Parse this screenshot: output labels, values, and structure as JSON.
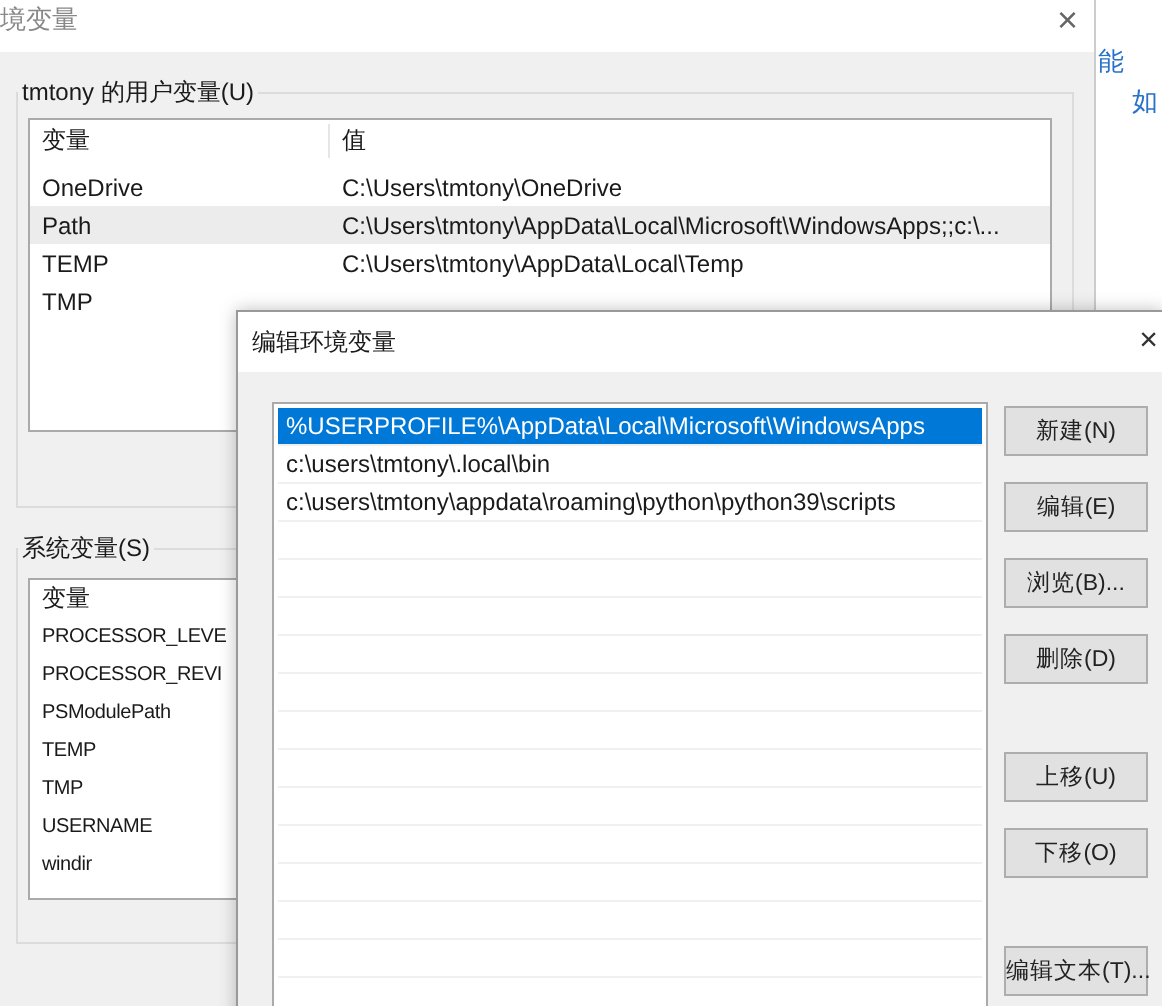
{
  "main_window": {
    "title": "境变量",
    "close": "×",
    "user_group": {
      "title": "tmtony 的用户变量(U)",
      "columns": [
        "变量",
        "值"
      ],
      "rows": [
        {
          "name": "OneDrive",
          "value": "C:\\Users\\tmtony\\OneDrive",
          "selected": false
        },
        {
          "name": "Path",
          "value": "C:\\Users\\tmtony\\AppData\\Local\\Microsoft\\WindowsApps;;c:\\...",
          "selected": true
        },
        {
          "name": "TEMP",
          "value": "C:\\Users\\tmtony\\AppData\\Local\\Temp",
          "selected": false
        },
        {
          "name": "TMP",
          "selected": false
        }
      ]
    },
    "system_group": {
      "title": "系统变量(S)",
      "columns": [
        "变量"
      ],
      "rows": [
        {
          "name": "PROCESSOR_LEVE"
        },
        {
          "name": "PROCESSOR_REVI"
        },
        {
          "name": "PSModulePath"
        },
        {
          "name": "TEMP"
        },
        {
          "name": "TMP"
        },
        {
          "name": "USERNAME"
        },
        {
          "name": "windir"
        }
      ]
    }
  },
  "side_links": [
    "能",
    "如"
  ],
  "dialog": {
    "title": "编辑环境变量",
    "close": "×",
    "paths": [
      {
        "text": "%USERPROFILE%\\AppData\\Local\\Microsoft\\WindowsApps",
        "selected": true
      },
      {
        "text": "c:\\users\\tmtony\\.local\\bin",
        "selected": false
      },
      {
        "text": "c:\\users\\tmtony\\appdata\\roaming\\python\\python39\\scripts",
        "selected": false
      }
    ],
    "button_groups": [
      [
        "新建(N)",
        "编辑(E)",
        "浏览(B)...",
        "删除(D)"
      ],
      [
        "上移(U)",
        "下移(O)"
      ],
      [
        "编辑文本(T)..."
      ]
    ]
  }
}
